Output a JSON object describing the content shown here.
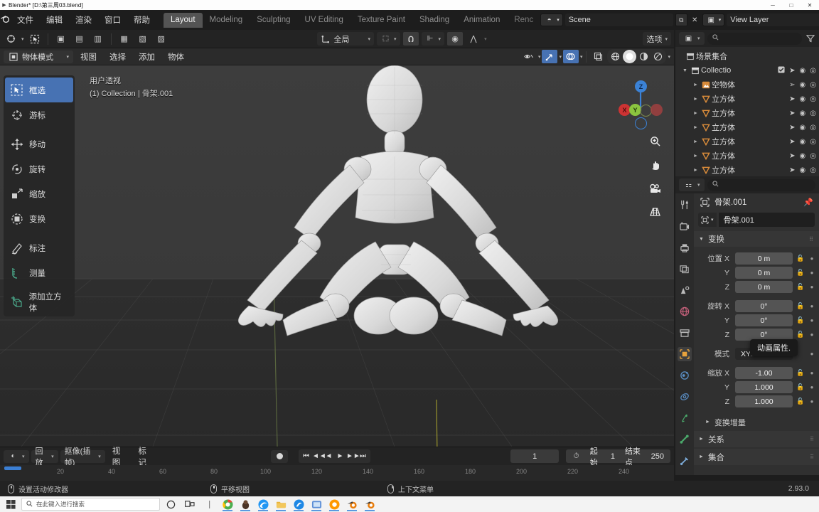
{
  "window": {
    "title": "Blender* [D:\\第三周03.blend]",
    "minimize": "─",
    "maximize": "□",
    "close": "✕"
  },
  "topbar": {
    "logo_icon": "blender-logo-icon",
    "menus": [
      "文件",
      "编辑",
      "渲染",
      "窗口",
      "帮助"
    ],
    "tabs": [
      "Layout",
      "Modeling",
      "Sculpting",
      "UV Editing",
      "Texture Paint",
      "Shading",
      "Animation",
      "Renc"
    ],
    "active_tab": "Layout",
    "scene_name": "Scene",
    "view_layer_name": "View Layer",
    "scene_icon": "scene-icon",
    "view_layer_icon": "view-layer-icon",
    "copy_icon": "duplicate-icon",
    "close_icon": "x-icon"
  },
  "viewport_header": {
    "transform_orientation": "全局",
    "orientation_icon": "orientation-gizmo-icon",
    "snap_icon": "snap-magnet-icon",
    "proportional_icon": "proportional-editing-icon",
    "proportional_falloff_icon": "falloff-curve-icon",
    "mirror_icon": "mirror-icon",
    "curve_icon": "curve-icon",
    "options_label": "选项",
    "cursor_icon": "cursor-icon",
    "select_box_icon": "select-box-icon",
    "editor_type_icon": "editor-type-icon"
  },
  "mode_row": {
    "mode": "物体模式",
    "mode_icon": "object-mode-icon",
    "menus": [
      "视图",
      "选择",
      "添加",
      "物体"
    ],
    "visibility_icon": "visibility-eye-icon",
    "gizmo_icon": "gizmo-arrow-icon",
    "overlay_icon": "overlays-icon",
    "xray_icon": "xray-icon",
    "shading_modes": [
      "wireframe",
      "solid",
      "material",
      "rendered"
    ],
    "active_shading": "solid"
  },
  "viewport": {
    "perspective_label": "用户透视",
    "object_path": "(1) Collection | 骨架.001",
    "tool_shelf": [
      {
        "label": "框选",
        "icon": "select-box-icon",
        "selected": true
      },
      {
        "label": "游标",
        "icon": "cursor-3d-icon",
        "selected": false
      },
      {
        "label": "移动",
        "icon": "move-icon",
        "selected": false
      },
      {
        "label": "旋转",
        "icon": "rotate-icon",
        "selected": false
      },
      {
        "label": "缩放",
        "icon": "scale-icon",
        "selected": false
      },
      {
        "label": "变换",
        "icon": "transform-icon",
        "selected": false
      },
      {
        "label": "标注",
        "icon": "annotate-icon",
        "selected": false
      },
      {
        "label": "测量",
        "icon": "measure-icon",
        "selected": false
      },
      {
        "label": "添加立方体",
        "icon": "add-cube-icon",
        "selected": false
      }
    ],
    "gizmo_axes": [
      {
        "label": "X",
        "color": "#cc3333"
      },
      {
        "label": "Y",
        "color": "#8bc53f"
      },
      {
        "label": "Z",
        "color": "#3b82d6"
      }
    ],
    "nav_buttons": [
      {
        "icon": "zoom-icon",
        "name": "zoom-view-button"
      },
      {
        "icon": "hand-icon",
        "name": "pan-view-button"
      },
      {
        "icon": "camera-icon",
        "name": "camera-view-button"
      },
      {
        "icon": "grid-icon",
        "name": "toggle-perspective-button"
      }
    ]
  },
  "timeline": {
    "editor_icon": "timeline-editor-icon",
    "menus": [
      "回放",
      "抠像(插帧)",
      "视图",
      "标记"
    ],
    "menu_has_dropdown": [
      true,
      true,
      false,
      false
    ],
    "record_icon": "record-icon",
    "playback": [
      "jump-start-icon",
      "prev-keyframe-icon",
      "play-reverse-icon",
      "play-icon",
      "next-keyframe-icon",
      "jump-end-icon"
    ],
    "current_frame": "1",
    "clock_icon": "clock-icon",
    "start_label": "起始",
    "start_value": "1",
    "end_label": "结束点",
    "end_value": "250",
    "ruler_ticks": [
      "20",
      "40",
      "60",
      "80",
      "100",
      "120",
      "140",
      "160",
      "180",
      "200",
      "220",
      "240"
    ]
  },
  "outliner": {
    "editor_icon": "outliner-editor-icon",
    "search_placeholder": "",
    "search_icon": "search-icon",
    "filter_icon": "filter-funnel-icon",
    "rows": [
      {
        "label": "场景集合",
        "icon": "collection-icon",
        "indent": 1,
        "arrow": "",
        "checkbox": false,
        "controls": false
      },
      {
        "label": "Collectio",
        "icon": "collection-icon",
        "indent": 2,
        "arrow": "▼",
        "checkbox": true,
        "controls": true
      },
      {
        "label": "空物体",
        "icon": "empty-image-icon",
        "indent": 3,
        "arrow": "►",
        "checkbox": false,
        "controls": true
      },
      {
        "label": "立方体",
        "icon": "mesh-icon",
        "indent": 3,
        "arrow": "►",
        "checkbox": false,
        "controls": true
      },
      {
        "label": "立方体",
        "icon": "mesh-icon",
        "indent": 3,
        "arrow": "►",
        "checkbox": false,
        "controls": true
      },
      {
        "label": "立方体",
        "icon": "mesh-icon",
        "indent": 3,
        "arrow": "►",
        "checkbox": false,
        "controls": true
      },
      {
        "label": "立方体",
        "icon": "mesh-icon",
        "indent": 3,
        "arrow": "►",
        "checkbox": false,
        "controls": true
      },
      {
        "label": "立方体",
        "icon": "mesh-icon",
        "indent": 3,
        "arrow": "►",
        "checkbox": false,
        "controls": true
      },
      {
        "label": "立方体",
        "icon": "mesh-icon",
        "indent": 3,
        "arrow": "►",
        "checkbox": false,
        "controls": true
      }
    ]
  },
  "properties": {
    "editor_icon": "properties-editor-icon",
    "search_icon": "search-icon",
    "tabs": [
      {
        "icon": "tool-wrench-icon",
        "name": "tab-tool",
        "active": false
      },
      {
        "icon": "render-camera-icon",
        "name": "tab-render",
        "active": false
      },
      {
        "icon": "printer-output-icon",
        "name": "tab-output",
        "active": false
      },
      {
        "icon": "view-layer-images-icon",
        "name": "tab-view-layer",
        "active": false
      },
      {
        "icon": "scene-cone-icon",
        "name": "tab-scene",
        "active": false
      },
      {
        "icon": "world-globe-icon",
        "name": "tab-world",
        "active": false
      },
      {
        "icon": "collection-box-icon",
        "name": "tab-collection",
        "active": false
      },
      {
        "icon": "object-square-icon",
        "name": "tab-object",
        "active": true
      },
      {
        "icon": "modifier-wrench-icon",
        "name": "tab-modifiers",
        "active": false
      },
      {
        "icon": "particles-icon",
        "name": "tab-particles",
        "active": false
      },
      {
        "icon": "physics-icon",
        "name": "tab-physics",
        "active": false
      },
      {
        "icon": "constraints-bone-icon",
        "name": "tab-constraints",
        "active": false
      },
      {
        "icon": "data-armature-icon",
        "name": "tab-data",
        "active": false
      }
    ],
    "breadcrumb_object": "骨架.001",
    "breadcrumb_icon": "object-square-icon",
    "pin_icon": "pin-icon",
    "object_name": "骨架.001",
    "transform_panel": "变换",
    "location": {
      "label": "位置",
      "axes": [
        "X",
        "Y",
        "Z"
      ],
      "values": [
        "0 m",
        "0 m",
        "0 m"
      ]
    },
    "rotation": {
      "label": "旋转",
      "axes": [
        "X",
        "Y",
        "Z"
      ],
      "values": [
        "0°",
        "0°",
        "0°"
      ]
    },
    "rotation_mode": {
      "label": "模式",
      "value": "XYZ ..."
    },
    "scale": {
      "label": "缩放",
      "axes": [
        "X",
        "Y",
        "Z"
      ],
      "values": [
        "-1.00",
        "1.000",
        "1.000"
      ]
    },
    "delta_transform": "变换增量",
    "relations": "关系",
    "collections": "集合",
    "lock_icon": "unlock-icon",
    "animate_icon": "animate-dot-icon"
  },
  "tooltip": {
    "text": "动画属性."
  },
  "statusbar": {
    "items": [
      {
        "icon": "mouse-left-icon",
        "text": "设置活动修改器"
      },
      {
        "icon": "mouse-middle-icon",
        "text": "平移视图"
      },
      {
        "icon": "mouse-right-icon",
        "text": "上下文菜单"
      }
    ],
    "version": "2.93.0"
  },
  "taskbar": {
    "start_icon": "windows-start-icon",
    "search_placeholder": "在此键入进行搜索",
    "search_icon": "search-icon",
    "cortana_icon": "cortana-circle-icon",
    "taskview_icon": "task-view-icon",
    "apps": [
      {
        "name": "chrome-app",
        "color": "#4CAF50"
      },
      {
        "name": "dark-app",
        "color": "#4a3325"
      },
      {
        "name": "edge-app",
        "color": "#2196F3"
      },
      {
        "name": "folder-app",
        "color": "#E8B339"
      },
      {
        "name": "blue-app",
        "color": "#1e88e5"
      },
      {
        "name": "screenshot-app",
        "color": "#5c8ed6"
      },
      {
        "name": "orange-app",
        "color": "#FF9800"
      },
      {
        "name": "blender-app-1",
        "color": "#E87D0D"
      },
      {
        "name": "blender-app-2",
        "color": "#E87D0D"
      }
    ]
  }
}
